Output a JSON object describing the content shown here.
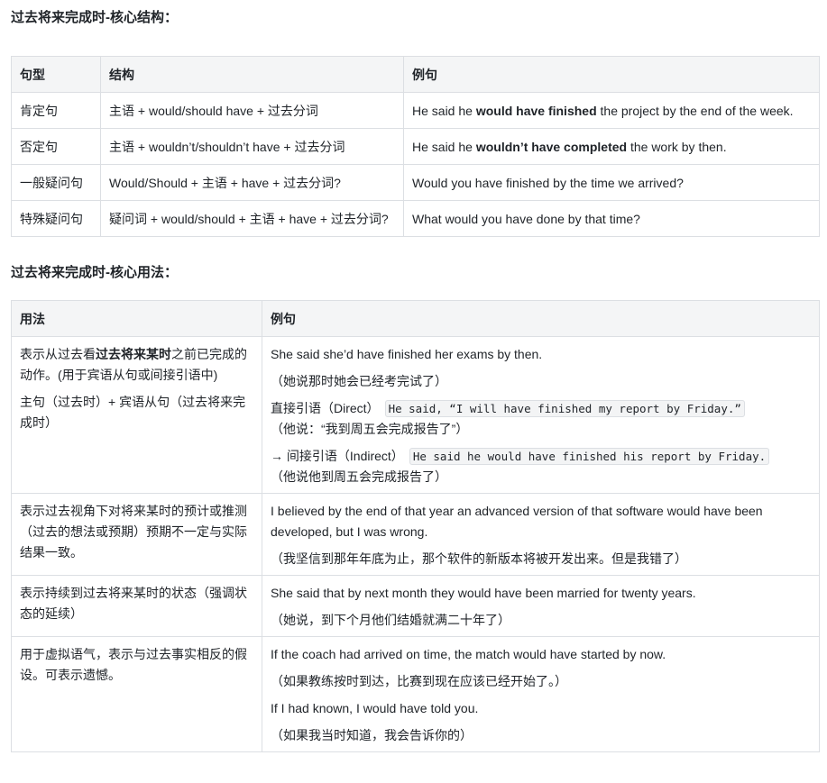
{
  "section1": {
    "title": "过去将来完成时-核心结构：",
    "headers": [
      "句型",
      "结构",
      "例句"
    ],
    "rows": [
      {
        "type": "肯定句",
        "structure": "主语 + would/should have + 过去分词",
        "ex_pre": "He said he ",
        "ex_bold": "would have finished",
        "ex_post": " the project by the end of the week."
      },
      {
        "type": "否定句",
        "structure": "主语 + wouldn’t/shouldn’t have + 过去分词",
        "ex_pre": "He said he ",
        "ex_bold": "wouldn’t have completed",
        "ex_post": " the work by then."
      },
      {
        "type": "一般疑问句",
        "structure": "Would/Should + 主语 + have + 过去分词?",
        "ex_pre": "Would you have finished by the time we arrived?",
        "ex_bold": "",
        "ex_post": ""
      },
      {
        "type": "特殊疑问句",
        "structure": "疑问词 + would/should + 主语 + have + 过去分词?",
        "ex_pre": "What would you have done by that time?",
        "ex_bold": "",
        "ex_post": ""
      }
    ]
  },
  "section2": {
    "title": "过去将来完成时-核心用法：",
    "headers": [
      "用法",
      "例句"
    ],
    "row1": {
      "usage_pre": "表示从过去看",
      "usage_bold": "过去将来某时",
      "usage_post": "之前已完成的动作。(用于宾语从句或间接引语中)",
      "usage_note": "主句（过去时）+ 宾语从句（过去将来完成时）",
      "ex1": "She said she’d have finished her exams by then.",
      "ex1_cn": "（她说那时她会已经考完试了）",
      "direct_label": "直接引语（Direct）",
      "direct_code": "He said, “I will have finished my report by Friday.”",
      "direct_cn": "（他说：“我到周五会完成报告了”）",
      "indirect_label": "→ 间接引语（Indirect）",
      "indirect_code": "He said he would have finished his report by Friday.",
      "indirect_cn": "（他说他到周五会完成报告了）"
    },
    "row2": {
      "usage": "表示过去视角下对将来某时的预计或推测（过去的想法或预期）预期不一定与实际结果一致。",
      "ex": "I believed by the end of that year an advanced version of that software would have been developed, but I was wrong.",
      "ex_cn": "（我坚信到那年年底为止，那个软件的新版本将被开发出来。但是我错了）"
    },
    "row3": {
      "usage": "表示持续到过去将来某时的状态（强调状态的延续）",
      "ex": "She said that by next month they would have been married for twenty years.",
      "ex_cn": "（她说，到下个月他们结婚就满二十年了）"
    },
    "row4": {
      "usage": "用于虚拟语气，表示与过去事实相反的假设。可表示遗憾。",
      "ex1": "If the coach had arrived on time, the match would have started by now.",
      "ex1_cn": "（如果教练按时到达，比赛到现在应该已经开始了。）",
      "ex2": "If I had known, I would have told you.",
      "ex2_cn": "（如果我当时知道，我会告诉你的）"
    }
  }
}
